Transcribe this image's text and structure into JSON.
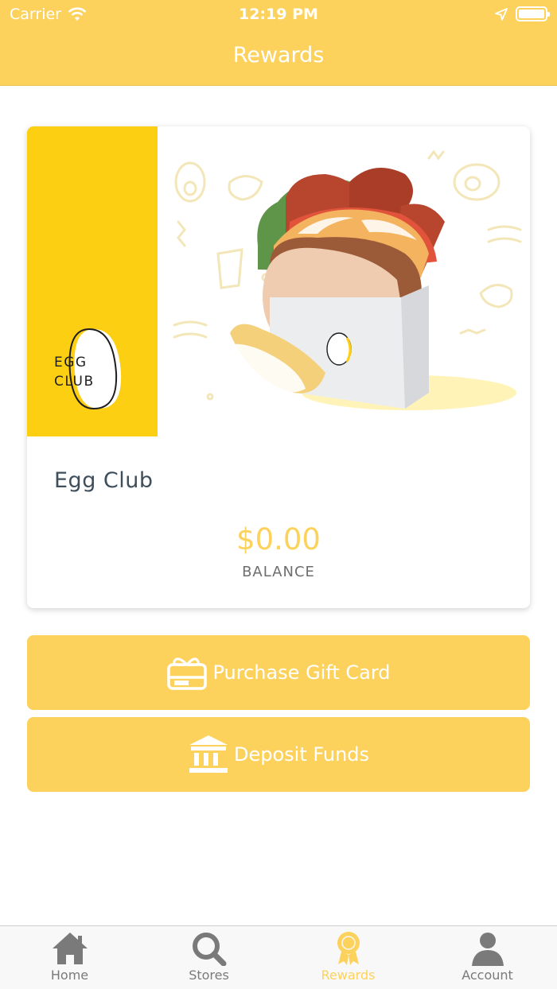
{
  "status_bar": {
    "carrier": "Carrier",
    "time": "12:19 PM"
  },
  "nav": {
    "title": "Rewards"
  },
  "card": {
    "brand_logo_text": "EGG CLUB",
    "name": "Egg Club",
    "balance": "$0.00",
    "balance_label": "BALANCE"
  },
  "actions": {
    "purchase_gift_card": "Purchase Gift Card",
    "deposit_funds": "Deposit Funds"
  },
  "tabs": [
    {
      "label": "Home",
      "icon": "home-icon"
    },
    {
      "label": "Stores",
      "icon": "search-icon"
    },
    {
      "label": "Rewards",
      "icon": "rewards-badge-icon",
      "active": true
    },
    {
      "label": "Account",
      "icon": "person-icon"
    }
  ],
  "colors": {
    "accent": "#FDD25C",
    "brand_yellow": "#FCCF12",
    "tab_inactive": "#7A7A7A"
  }
}
